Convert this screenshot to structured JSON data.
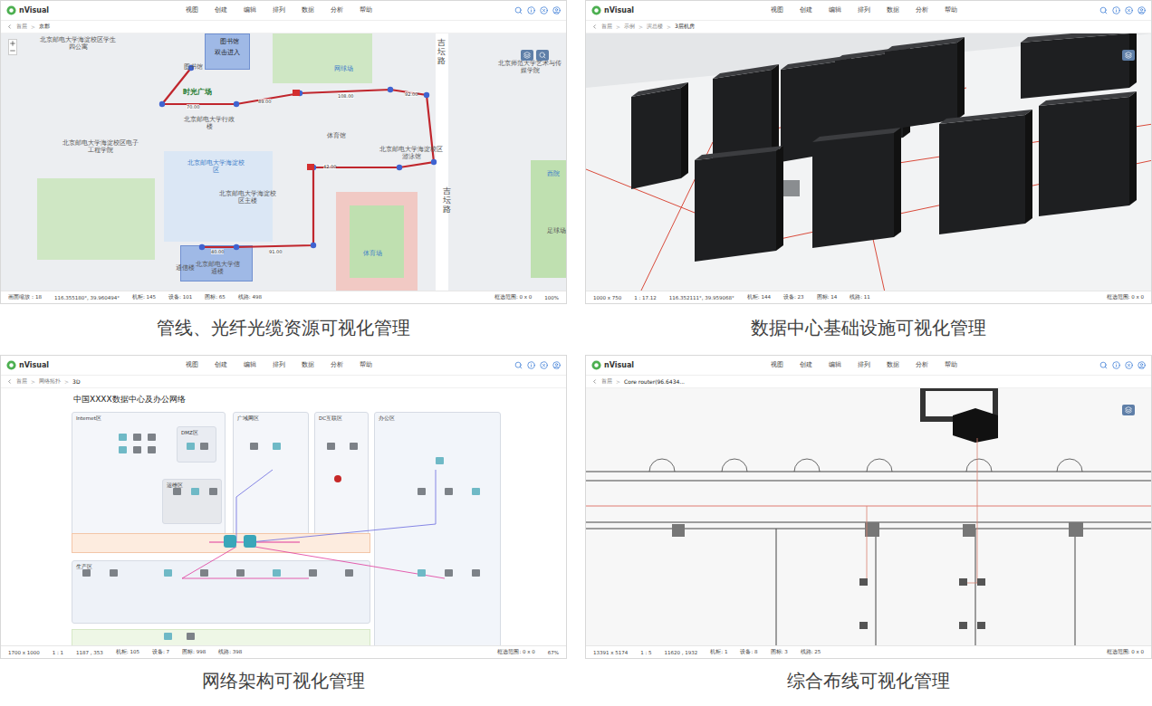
{
  "panels": [
    {
      "app": "nVisual",
      "menu": [
        "视图",
        "创建",
        "编辑",
        "排列",
        "数据",
        "分析",
        "帮助"
      ],
      "breadcrumb": [
        "首层",
        "京郡"
      ],
      "status_left": [
        "画面缩放：18",
        "116.355180°, 39.960494°",
        "机柜: 145",
        "设备: 101",
        "图标: 65",
        "线路: 498"
      ],
      "status_right": [
        "框选范围: 0 x 0",
        "100%"
      ],
      "caption": "管线、光纤光缆资源可视化管理"
    },
    {
      "app": "nVisual",
      "menu": [
        "视图",
        "创建",
        "编辑",
        "排列",
        "数据",
        "分析",
        "帮助"
      ],
      "breadcrumb": [
        "首层",
        "示例",
        "滨总楼",
        "3层机房"
      ],
      "status_left": [
        "1000 x 750",
        "1 : 17.12",
        "116.352111°, 39.959068°",
        "机柜: 144",
        "设备: 23",
        "图标: 14",
        "线路: 11"
      ],
      "status_right": [
        "框选范围: 0 x 0"
      ],
      "caption": "数据中心基础设施可视化管理"
    },
    {
      "app": "nVisual",
      "menu": [
        "视图",
        "创建",
        "编辑",
        "排列",
        "数据",
        "分析",
        "帮助"
      ],
      "breadcrumb": [
        "首层",
        "网络拓扑",
        "3D"
      ],
      "status_left": [
        "1700 x 1000",
        "1 : 1",
        "1187 , 353",
        "机柜: 105",
        "设备: 7",
        "图标: 998",
        "线路: 398"
      ],
      "status_right": [
        "框选范围: 0 x 0",
        "67%"
      ],
      "caption": "网络架构可视化管理"
    },
    {
      "app": "nVisual",
      "menu": [
        "视图",
        "创建",
        "编辑",
        "排列",
        "数据",
        "分析",
        "帮助"
      ],
      "breadcrumb": [
        "首层",
        "Core router(96.6434..."
      ],
      "status_left": [
        "13391 x 5174",
        "1 : 5",
        "11620 , 1932",
        "机柜: 1",
        "设备: 8",
        "图标: 3",
        "线路: 25"
      ],
      "status_right": [
        "框选范围: 0 x 0"
      ],
      "caption": "综合布线可视化管理"
    }
  ],
  "map": {
    "labels": [
      {
        "text": "图书馆",
        "kind": "building"
      },
      {
        "text": "双击进入",
        "kind": "building"
      },
      {
        "text": "图书馆",
        "kind": "poi"
      },
      {
        "text": "时光广场",
        "kind": "plaza"
      },
      {
        "text": "北京邮电大学海淀校区学生四公寓",
        "kind": "poi"
      },
      {
        "text": "北京邮电大学行政楼",
        "kind": "poi"
      },
      {
        "text": "北京邮电大学海淀校区",
        "kind": "area"
      },
      {
        "text": "体育馆",
        "kind": "poi"
      },
      {
        "text": "网球场",
        "kind": "area"
      },
      {
        "text": "北京邮电大学海淀校区游泳馆",
        "kind": "poi"
      },
      {
        "text": "北京邮电大学海淀校区电子工程学院",
        "kind": "poi"
      },
      {
        "text": "体育场",
        "kind": "area"
      },
      {
        "text": "通信楼",
        "kind": "poi"
      },
      {
        "text": "北京邮电大学信通楼",
        "kind": "poi"
      },
      {
        "text": "北京师范大学艺术与传媒学院",
        "kind": "poi"
      },
      {
        "text": "足球场",
        "kind": "poi"
      },
      {
        "text": "西院",
        "kind": "area"
      },
      {
        "text": "北京邮电大学海淀校区主楼",
        "kind": "poi"
      }
    ],
    "distances": [
      "70.00",
      "89.00",
      "108.00",
      "92.00",
      "42.00",
      "40.00",
      "91.00"
    ],
    "roads": [
      "吉坛路",
      "吉坛路"
    ]
  },
  "network": {
    "title": "中国XXXX数据中心及办公网络",
    "zones": [
      "Internet区",
      "广域网区",
      "DC互联区",
      "DMZ区",
      "运维区",
      "办公区",
      "生产区"
    ]
  }
}
